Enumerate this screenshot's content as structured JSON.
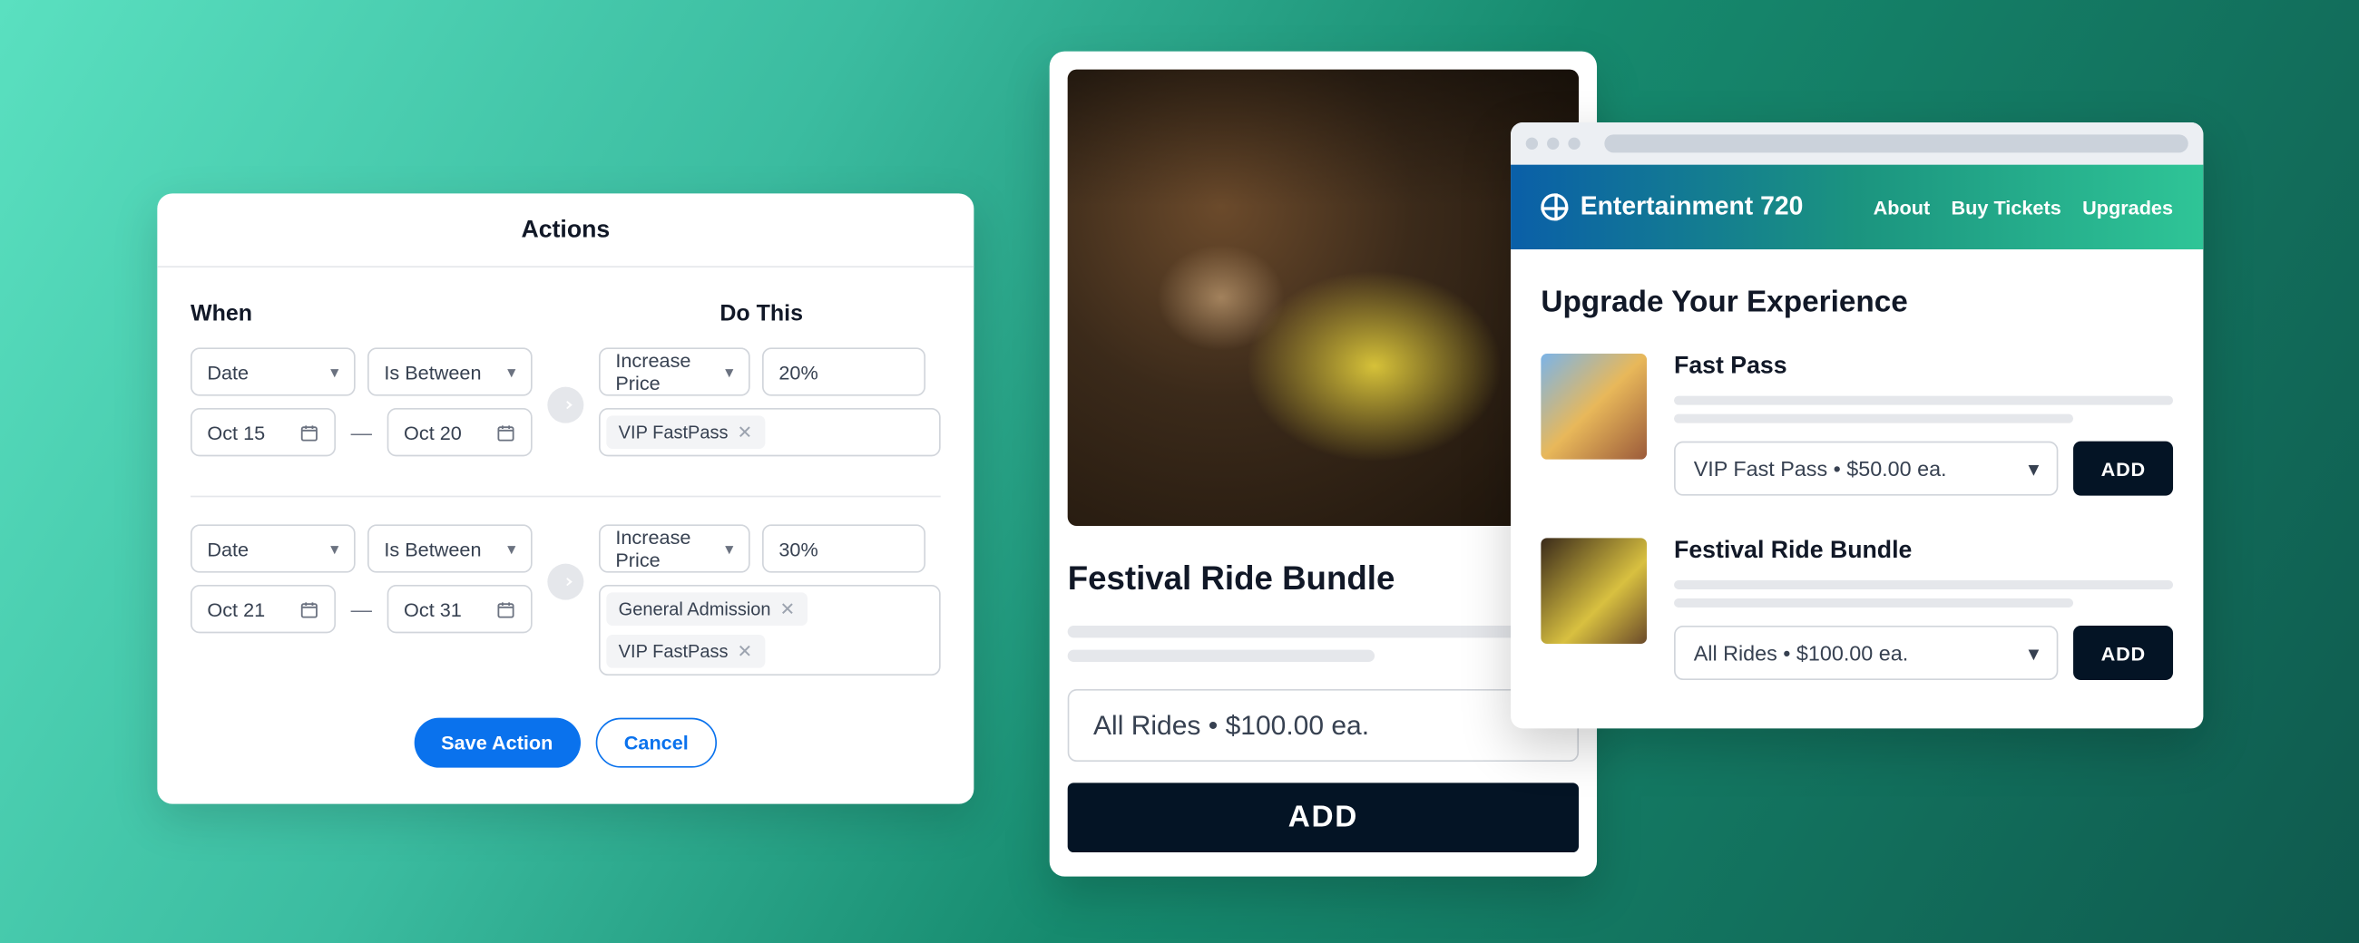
{
  "actions": {
    "title": "Actions",
    "labels": {
      "when": "When",
      "dothis": "Do This"
    },
    "rules": [
      {
        "condition_field": "Date",
        "operator": "Is Between",
        "date_from": "Oct 15",
        "date_to": "Oct 20",
        "action": "Increase Price",
        "amount": "20%",
        "tags": [
          "VIP FastPass"
        ]
      },
      {
        "condition_field": "Date",
        "operator": "Is Between",
        "date_from": "Oct 21",
        "date_to": "Oct 31",
        "action": "Increase Price",
        "amount": "30%",
        "tags": [
          "General Admission",
          "VIP FastPass"
        ]
      }
    ],
    "save_label": "Save Action",
    "cancel_label": "Cancel"
  },
  "bundle": {
    "title": "Festival Ride Bundle",
    "option": "All Rides  •  $100.00 ea.",
    "add_label": "ADD"
  },
  "site": {
    "brand": "Entertainment 720",
    "nav": {
      "about": "About",
      "buy": "Buy Tickets",
      "upgrades": "Upgrades"
    },
    "section_title": "Upgrade Your Experience",
    "items": [
      {
        "name": "Fast Pass",
        "option": "VIP Fast Pass • $50.00 ea.",
        "add": "ADD"
      },
      {
        "name": "Festival Ride Bundle",
        "option": "All Rides  •  $100.00 ea.",
        "add": "ADD"
      }
    ]
  }
}
